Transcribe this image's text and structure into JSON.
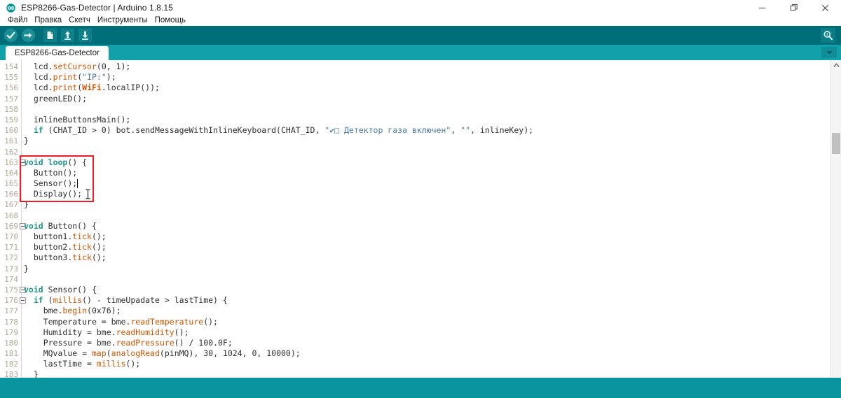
{
  "window": {
    "title": "ESP8266-Gas-Detector | Arduino 1.8.15",
    "logo_icon": "arduino-logo-icon",
    "minimize_icon": "minimize-icon",
    "restore_icon": "restore-icon",
    "close_icon": "close-icon"
  },
  "menubar": {
    "items": [
      {
        "label": "Файл"
      },
      {
        "label": "Правка"
      },
      {
        "label": "Скетч"
      },
      {
        "label": "Инструменты"
      },
      {
        "label": "Помощь"
      }
    ]
  },
  "toolbar": {
    "verify_icon": "check-circle-icon",
    "upload_icon": "arrow-right-circle-icon",
    "new_icon": "new-file-icon",
    "open_icon": "open-folder-up-arrow-icon",
    "save_icon": "save-down-arrow-icon",
    "serial_monitor_icon": "magnifier-serial-monitor-icon"
  },
  "tabs": {
    "active": "ESP8266-Gas-Detector",
    "items": [
      {
        "label": "ESP8266-Gas-Detector"
      }
    ],
    "dropdown_icon": "chevron-down-icon"
  },
  "scrollbar": {
    "up_arrow_icon": "chevron-up-icon"
  },
  "colors": {
    "toolbar_teal": "#006e78",
    "tabstrip_teal": "#12a1ab",
    "statusbar_teal": "#0a94a0",
    "annotation_red": "#ee1c25",
    "keyword": "#21968f",
    "function": "#d35400",
    "string": "#4a7ba6",
    "line_number": "#b0a99a"
  },
  "annotation": {
    "type": "red-rectangle",
    "covers_lines": [
      163,
      166
    ],
    "label": "loop-function-highlight"
  },
  "cursors": {
    "text_caret_line": 165,
    "text_caret_after": "Sensor();",
    "mouse_ibeam_line": 166,
    "mouse_ibeam_after": "Display();"
  },
  "editor": {
    "first_visible_line": 154,
    "last_visible_line": 183,
    "lines": [
      {
        "n": 154,
        "fold": false,
        "indent": 1,
        "tokens": [
          {
            "t": "lcd",
            "c": "plain"
          },
          {
            "t": ".",
            "c": "plain"
          },
          {
            "t": "setCursor",
            "c": "fn"
          },
          {
            "t": "(0, 1);",
            "c": "plain"
          }
        ]
      },
      {
        "n": 155,
        "fold": false,
        "indent": 1,
        "tokens": [
          {
            "t": "lcd",
            "c": "plain"
          },
          {
            "t": ".",
            "c": "plain"
          },
          {
            "t": "print",
            "c": "fn"
          },
          {
            "t": "(",
            "c": "plain"
          },
          {
            "t": "\"IP:\"",
            "c": "str"
          },
          {
            "t": ");",
            "c": "plain"
          }
        ]
      },
      {
        "n": 156,
        "fold": false,
        "indent": 1,
        "tokens": [
          {
            "t": "lcd",
            "c": "plain"
          },
          {
            "t": ".",
            "c": "plain"
          },
          {
            "t": "print",
            "c": "fn"
          },
          {
            "t": "(",
            "c": "plain"
          },
          {
            "t": "WiFi",
            "c": "cls"
          },
          {
            "t": ".localIP());",
            "c": "plain"
          }
        ]
      },
      {
        "n": 157,
        "fold": false,
        "indent": 1,
        "tokens": [
          {
            "t": "greenLED();",
            "c": "plain"
          }
        ]
      },
      {
        "n": 158,
        "fold": false,
        "indent": 0,
        "tokens": []
      },
      {
        "n": 159,
        "fold": false,
        "indent": 1,
        "tokens": [
          {
            "t": "inlineButtonsMain();",
            "c": "plain"
          }
        ]
      },
      {
        "n": 160,
        "fold": false,
        "indent": 1,
        "tokens": [
          {
            "t": "if",
            "c": "kw"
          },
          {
            "t": " (CHAT_ID > 0) bot.sendMessageWithInlineKeyboard(CHAT_ID, ",
            "c": "plain"
          },
          {
            "t": "\"✔□ Детектор газа включен\"",
            "c": "str"
          },
          {
            "t": ", ",
            "c": "plain"
          },
          {
            "t": "\"\"",
            "c": "str"
          },
          {
            "t": ", inlineKey);",
            "c": "plain"
          }
        ]
      },
      {
        "n": 161,
        "fold": false,
        "indent": 0,
        "tokens": [
          {
            "t": "}",
            "c": "plain"
          }
        ]
      },
      {
        "n": 162,
        "fold": false,
        "indent": 0,
        "tokens": []
      },
      {
        "n": 163,
        "fold": true,
        "indent": 0,
        "tokens": [
          {
            "t": "void",
            "c": "kw"
          },
          {
            "t": " ",
            "c": "plain"
          },
          {
            "t": "loop",
            "c": "kw"
          },
          {
            "t": "() {",
            "c": "plain"
          }
        ]
      },
      {
        "n": 164,
        "fold": false,
        "indent": 1,
        "tokens": [
          {
            "t": "Button();",
            "c": "plain"
          }
        ]
      },
      {
        "n": 165,
        "fold": false,
        "indent": 1,
        "tokens": [
          {
            "t": "Sensor();",
            "c": "plain"
          }
        ]
      },
      {
        "n": 166,
        "fold": false,
        "indent": 1,
        "tokens": [
          {
            "t": "Display();",
            "c": "plain"
          }
        ]
      },
      {
        "n": 167,
        "fold": false,
        "indent": 0,
        "tokens": [
          {
            "t": "}",
            "c": "plain"
          }
        ]
      },
      {
        "n": 168,
        "fold": false,
        "indent": 0,
        "tokens": []
      },
      {
        "n": 169,
        "fold": true,
        "indent": 0,
        "tokens": [
          {
            "t": "void",
            "c": "kw"
          },
          {
            "t": " Button() {",
            "c": "plain"
          }
        ]
      },
      {
        "n": 170,
        "fold": false,
        "indent": 1,
        "tokens": [
          {
            "t": "button1.",
            "c": "plain"
          },
          {
            "t": "tick",
            "c": "fn"
          },
          {
            "t": "();",
            "c": "plain"
          }
        ]
      },
      {
        "n": 171,
        "fold": false,
        "indent": 1,
        "tokens": [
          {
            "t": "button2.",
            "c": "plain"
          },
          {
            "t": "tick",
            "c": "fn"
          },
          {
            "t": "();",
            "c": "plain"
          }
        ]
      },
      {
        "n": 172,
        "fold": false,
        "indent": 1,
        "tokens": [
          {
            "t": "button3.",
            "c": "plain"
          },
          {
            "t": "tick",
            "c": "fn"
          },
          {
            "t": "();",
            "c": "plain"
          }
        ]
      },
      {
        "n": 173,
        "fold": false,
        "indent": 0,
        "tokens": [
          {
            "t": "}",
            "c": "plain"
          }
        ]
      },
      {
        "n": 174,
        "fold": false,
        "indent": 0,
        "tokens": []
      },
      {
        "n": 175,
        "fold": true,
        "indent": 0,
        "tokens": [
          {
            "t": "void",
            "c": "kw"
          },
          {
            "t": " Sensor() {",
            "c": "plain"
          }
        ]
      },
      {
        "n": 176,
        "fold": true,
        "indent": 1,
        "tokens": [
          {
            "t": "if",
            "c": "kw"
          },
          {
            "t": " (",
            "c": "plain"
          },
          {
            "t": "millis",
            "c": "fn"
          },
          {
            "t": "() - timeUpadate > lastTime) {",
            "c": "plain"
          }
        ]
      },
      {
        "n": 177,
        "fold": false,
        "indent": 2,
        "tokens": [
          {
            "t": "bme.",
            "c": "plain"
          },
          {
            "t": "begin",
            "c": "fn"
          },
          {
            "t": "(0x76);",
            "c": "plain"
          }
        ]
      },
      {
        "n": 178,
        "fold": false,
        "indent": 2,
        "tokens": [
          {
            "t": "Temperature = bme.",
            "c": "plain"
          },
          {
            "t": "readTemperature",
            "c": "fn"
          },
          {
            "t": "();",
            "c": "plain"
          }
        ]
      },
      {
        "n": 179,
        "fold": false,
        "indent": 2,
        "tokens": [
          {
            "t": "Humidity = bme.",
            "c": "plain"
          },
          {
            "t": "readHumidity",
            "c": "fn"
          },
          {
            "t": "();",
            "c": "plain"
          }
        ]
      },
      {
        "n": 180,
        "fold": false,
        "indent": 2,
        "tokens": [
          {
            "t": "Pressure = bme.",
            "c": "plain"
          },
          {
            "t": "readPressure",
            "c": "fn"
          },
          {
            "t": "() / 100.0F;",
            "c": "plain"
          }
        ]
      },
      {
        "n": 181,
        "fold": false,
        "indent": 2,
        "tokens": [
          {
            "t": "MQvalue = ",
            "c": "plain"
          },
          {
            "t": "map",
            "c": "fn"
          },
          {
            "t": "(",
            "c": "plain"
          },
          {
            "t": "analogRead",
            "c": "fn"
          },
          {
            "t": "(pinMQ), 30, 1024, 0, 10000);",
            "c": "plain"
          }
        ]
      },
      {
        "n": 182,
        "fold": false,
        "indent": 2,
        "tokens": [
          {
            "t": "lastTime = ",
            "c": "plain"
          },
          {
            "t": "millis",
            "c": "fn"
          },
          {
            "t": "();",
            "c": "plain"
          }
        ]
      },
      {
        "n": 183,
        "fold": false,
        "indent": 1,
        "tokens": [
          {
            "t": "}",
            "c": "plain"
          }
        ]
      }
    ]
  }
}
